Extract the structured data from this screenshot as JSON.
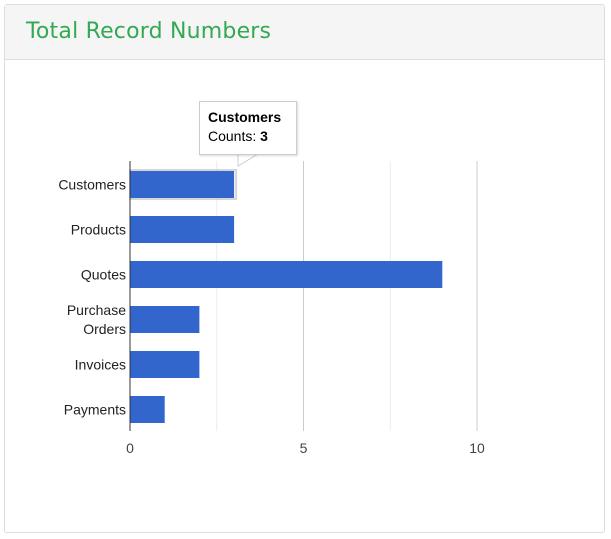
{
  "panel": {
    "title": "Total Record Numbers"
  },
  "tooltip": {
    "title": "Customers",
    "label": "Counts:",
    "value": "3"
  },
  "colors": {
    "bar": "#3366cc",
    "title": "#34a853"
  },
  "chart_data": {
    "type": "bar",
    "orientation": "horizontal",
    "categories": [
      "Customers",
      "Products",
      "Quotes",
      "Purchase Orders",
      "Invoices",
      "Payments"
    ],
    "category_lines": [
      [
        "Customers"
      ],
      [
        "Products"
      ],
      [
        "Quotes"
      ],
      [
        "Purchase",
        "Orders"
      ],
      [
        "Invoices"
      ],
      [
        "Payments"
      ]
    ],
    "series": [
      {
        "values": [
          3,
          3,
          9,
          2,
          2,
          1
        ]
      }
    ],
    "xticks": [
      "0",
      "5",
      "10"
    ],
    "xlim": [
      0,
      12
    ],
    "grid": true,
    "highlighted": "Customers"
  }
}
